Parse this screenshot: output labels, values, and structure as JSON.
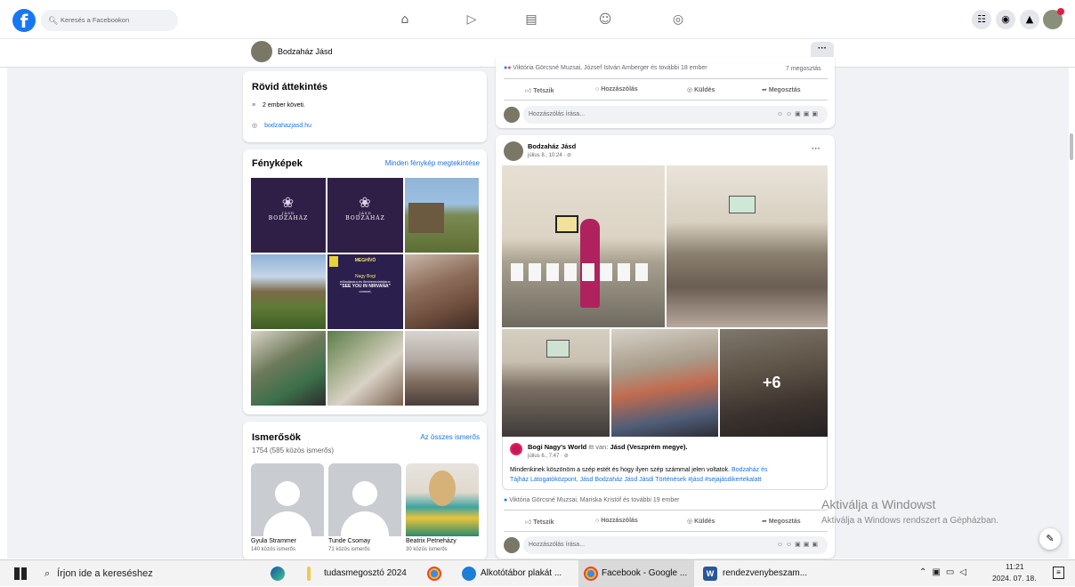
{
  "topbar": {
    "logo": "f",
    "search_placeholder": "Keresés a Facebookon",
    "nav_icons": [
      "home-icon",
      "video-icon",
      "marketplace-icon",
      "groups-icon",
      "gaming-icon"
    ],
    "right_icons": [
      "menu-grid-icon",
      "messenger-icon",
      "bell-icon"
    ]
  },
  "page_header": {
    "name": "Bodzaház Jásd",
    "more": "···"
  },
  "overview": {
    "title": "Rövid áttekintés",
    "followers": "2 ember követi.",
    "website": "bodzahazjasd.hu"
  },
  "photos": {
    "title": "Fényképek",
    "see_all": "Minden fénykép megtekintése",
    "brand_small": "JÁSD",
    "brand_name": "BODZAHÁZ",
    "invite_title": "MEGHÍVÓ",
    "invite_lines": [
      "Nagy Bogi",
      "előadására és filmbemutatójára:",
      "\"SEE YOU IN NIRVANA\"",
      "címmel,"
    ]
  },
  "friends": {
    "title": "Ismerősök",
    "count": "1754 (585 közös ismerős)",
    "see_all": "Az összes ismerős",
    "items": [
      {
        "name": "Gyula Strammer",
        "mutual": "140 közös ismerős"
      },
      {
        "name": "Tunde Csomay",
        "mutual": "71 közös ismerős"
      },
      {
        "name": "Beatrix Petneházy",
        "mutual": "30 közös ismerős"
      }
    ]
  },
  "post1": {
    "reactions": "Viktória Görcsné Muzsai, József István Amberger és további 18 ember",
    "shares": "7 megosztás",
    "actions": [
      "Tetszik",
      "Hozzászólás",
      "Küldés",
      "Megosztás"
    ],
    "comment_placeholder": "Hozzászólás írása..."
  },
  "post2": {
    "author": "Bodzaház Jásd",
    "time": "július 8., 10:24 · ⊘",
    "more": "···",
    "plus_more": "+6",
    "shared_author": "Bogi Nagy's World",
    "shared_place_prefix": " itt van: ",
    "shared_place": "Jásd (Veszprém megye).",
    "shared_time": "július 6., 7:47 · ⊘",
    "text": "Mindenkinek köszönöm a szép estét és hogy ilyen szép számmal jelen voltatok.",
    "text_links_1": " Bodzaház és",
    "text_links_2": "Tájház Látogatóközpont, Jásd Bodzaház Jásd Jásdi Történések #jásd #sejajásdikertekalatt",
    "reactions": "Viktória Görcsné Muzsai, Mariska Kristóf és további 19 ember",
    "actions": [
      "Tetszik",
      "Hozzászólás",
      "Küldés",
      "Megosztás"
    ],
    "comment_placeholder": "Hozzászólás írása..."
  },
  "watermark": {
    "title": "Aktiválja a Windowst",
    "subtitle": "Aktiválja a Windows rendszert a Gépházban."
  },
  "taskbar": {
    "search": "Írjon ide a kereséshez",
    "items": [
      "tudasmegosztó 2024",
      "Alkotótábor plakát ...",
      "Facebook - Google ...",
      "rendezvenybeszam..."
    ],
    "time": "11:21",
    "date": "2024. 07. 18."
  }
}
